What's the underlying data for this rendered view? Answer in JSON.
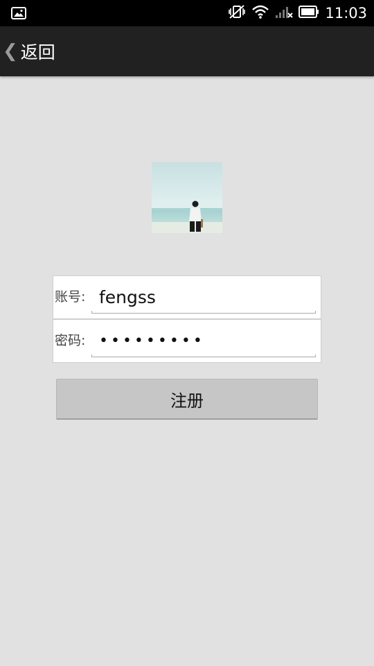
{
  "status_bar": {
    "time": "11:03",
    "icons": [
      "gallery-notification-icon",
      "vibrate-mute-icon",
      "wifi-icon",
      "cell-signal-no-data-icon",
      "battery-icon"
    ]
  },
  "title_bar": {
    "back_icon": "chevron-left",
    "back_label": "返回"
  },
  "avatar": {
    "description_icon": "profile-photo"
  },
  "form": {
    "account_label": "账号:",
    "account_value": "fengss",
    "password_label": "密码:",
    "password_value": "•••••••••"
  },
  "actions": {
    "register_label": "注册"
  },
  "colors": {
    "background": "#e1e1e1",
    "title_bar": "#212121",
    "status_bar": "#000000",
    "button": "#c6c6c6"
  }
}
